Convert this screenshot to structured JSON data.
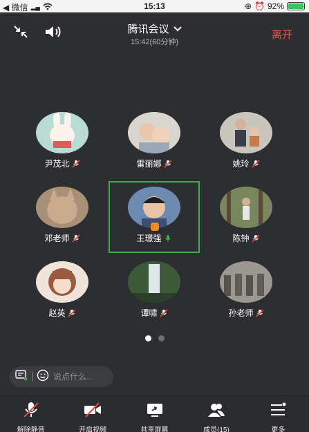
{
  "statusbar": {
    "carrier": "◀ 微信",
    "time": "15:13",
    "battery": "92%"
  },
  "topbar": {
    "title": "腾讯会议",
    "subtitle": "15:42(60分钟)",
    "leave_label": "离开"
  },
  "participants": [
    {
      "name": "尹茂北",
      "mic": "muted"
    },
    {
      "name": "雷丽娜",
      "mic": "muted"
    },
    {
      "name": "姚玲",
      "mic": "muted"
    },
    {
      "name": "邓老师",
      "mic": "muted"
    },
    {
      "name": "王璟强",
      "mic": "active"
    },
    {
      "name": "陈钟",
      "mic": "muted"
    },
    {
      "name": "赵英",
      "mic": "muted"
    },
    {
      "name": "谭啸",
      "mic": "muted"
    },
    {
      "name": "孙老师",
      "mic": "muted"
    }
  ],
  "pager": {
    "pages": 2,
    "current": 1
  },
  "chat": {
    "placeholder": "说点什么..."
  },
  "toolbar": {
    "unmute_label": "解除静音",
    "video_label": "开启视频",
    "share_label": "共享屏幕",
    "members_label": "成员(15)",
    "more_label": "更多"
  },
  "colors": {
    "leave": "#f0524d",
    "active_speaker": "#3fae49",
    "muted_mic": "#e04a3f"
  }
}
